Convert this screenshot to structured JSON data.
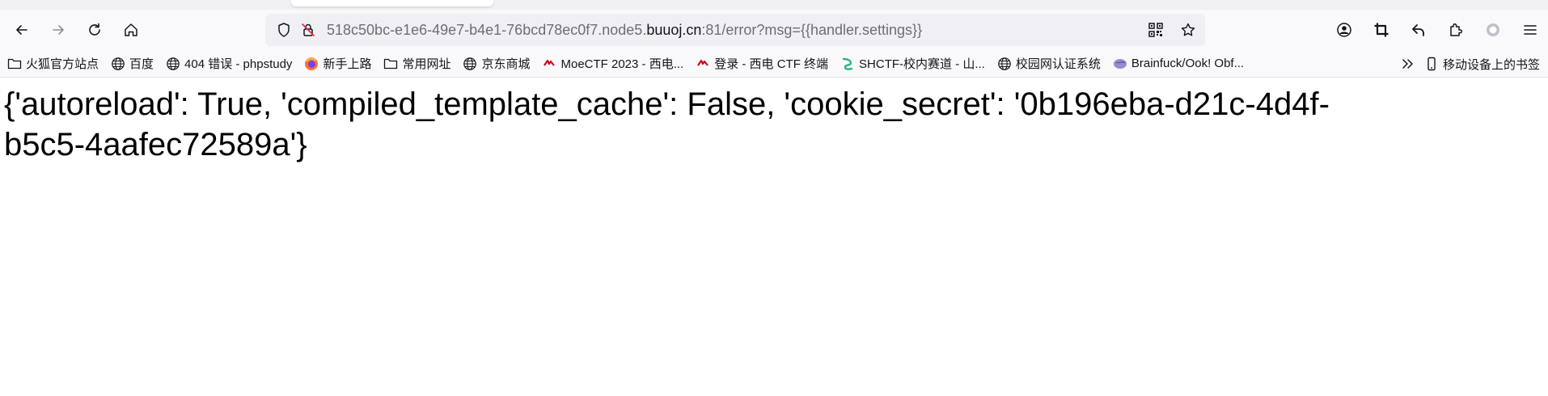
{
  "browser": {
    "url": {
      "prefix": "518c50bc-e1e6-49e7-b4e1-76bcd78ec0f7.node5.",
      "domain": "buuoj.cn",
      "suffix": ":81/error?msg={{handler.settings}}"
    },
    "nav_icons": [
      "back-icon",
      "forward-icon",
      "reload-icon",
      "home-icon"
    ],
    "toolbar_icons": [
      "account-icon",
      "screenshot-crop-icon",
      "undo-arrow-icon",
      "extensions-icon",
      "extension-circle-icon",
      "menu-icon"
    ]
  },
  "bookmarks": {
    "items": [
      {
        "label": "火狐官方站点",
        "icon": "folder-icon"
      },
      {
        "label": "百度",
        "icon": "globe-icon"
      },
      {
        "label": "404 错误 - phpstudy",
        "icon": "globe-icon"
      },
      {
        "label": "新手上路",
        "icon": "firefox-icon"
      },
      {
        "label": "常用网址",
        "icon": "folder-icon"
      },
      {
        "label": "京东商城",
        "icon": "globe-icon"
      },
      {
        "label": "MoeCTF 2023 - 西电...",
        "icon": "moectf-icon"
      },
      {
        "label": "登录 - 西电 CTF 终端",
        "icon": "xdctf-icon"
      },
      {
        "label": "SHCTF-校内赛道 - 山...",
        "icon": "shctf-icon"
      },
      {
        "label": "校园网认证系统",
        "icon": "globe-icon"
      },
      {
        "label": "Brainfuck/Ook! Obf...",
        "icon": "brain-icon"
      }
    ],
    "mobile_label": "移动设备上的书签"
  },
  "page": {
    "body_text": "{'autoreload': True, 'compiled_template_cache': False, 'cookie_secret': '0b196eba-d21c-4d4f-b5c5-4aafec72589a'}"
  },
  "colors": {
    "toolbar_bg": "#f9f9fb",
    "urlbar_bg": "#f0f0f4",
    "text": "#15141a",
    "firefox_orange": "#ff7139",
    "ctf_red": "#d70022",
    "shctf_green": "#2bb673",
    "brain_purple": "#7b68b8"
  }
}
